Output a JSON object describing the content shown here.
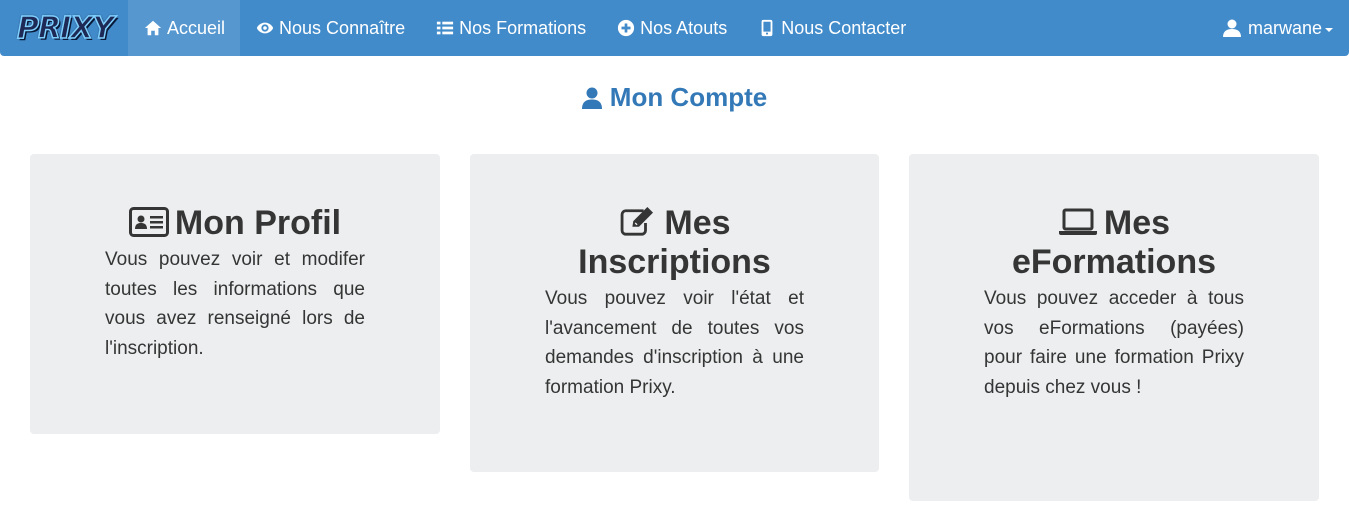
{
  "navbar": {
    "logo_text": "PRIXY",
    "items": [
      {
        "label": "Accueil",
        "icon": "home-icon",
        "active": true
      },
      {
        "label": "Nous Connaître",
        "icon": "eye-icon",
        "active": false
      },
      {
        "label": "Nos Formations",
        "icon": "list-icon",
        "active": false
      },
      {
        "label": "Nos Atouts",
        "icon": "plus-circle-icon",
        "active": false
      },
      {
        "label": "Nous Contacter",
        "icon": "mobile-icon",
        "active": false
      }
    ],
    "user": {
      "name": "marwane",
      "icon": "user-icon"
    },
    "colors": {
      "background": "#428bca",
      "active": "#5697d0"
    }
  },
  "page": {
    "title": "Mon Compte",
    "title_color": "#3479b7"
  },
  "cards": [
    {
      "title_line1": "Mon Profil",
      "text": "Vous pouvez voir et modifer toutes les informations que vous avez renseigné lors de l'inscription.",
      "icon": "id-card-icon"
    },
    {
      "title_line1": "Mes",
      "title_line2": "Inscriptions",
      "text": "Vous pouvez voir l'état et l'avancement de toutes vos demandes d'inscription à une formation Prixy.",
      "icon": "edit-icon"
    },
    {
      "title_line1": "Mes",
      "title_line2": "eFormations",
      "text": "Vous pouvez acceder à tous vos eFormations (payées) pour faire une formation Prixy depuis chez vous !",
      "icon": "laptop-icon"
    }
  ]
}
